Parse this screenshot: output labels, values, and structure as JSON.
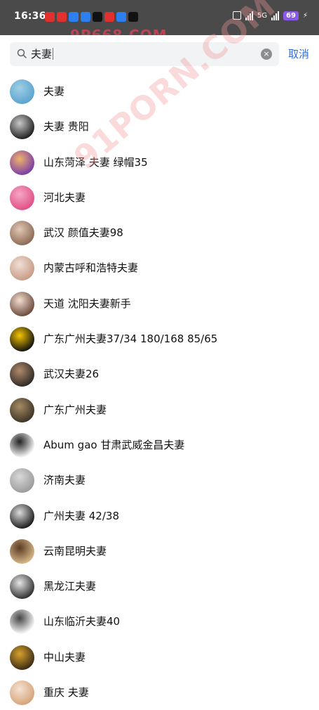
{
  "status_bar": {
    "time": "16:36",
    "battery": "69",
    "network": "5G"
  },
  "search": {
    "query": "夫妻",
    "cancel_label": "取消"
  },
  "results": [
    {
      "name": "夫妻",
      "avatar_colors": [
        "#5aa3cf",
        "#9fcfe3"
      ]
    },
    {
      "name": "夫妻  贵阳",
      "avatar_colors": [
        "#1f1f1f",
        "#c9c9c9"
      ]
    },
    {
      "name": "山东菏泽 夫妻  绿帽35",
      "avatar_colors": [
        "#7a3ca8",
        "#f0b36a"
      ]
    },
    {
      "name": "河北夫妻",
      "avatar_colors": [
        "#e04f86",
        "#f6a7c4"
      ]
    },
    {
      "name": "武汉 颜值夫妻98",
      "avatar_colors": [
        "#8a6a55",
        "#e2c7b4"
      ]
    },
    {
      "name": "内蒙古呼和浩特夫妻",
      "avatar_colors": [
        "#c89b86",
        "#f0dfd4"
      ]
    },
    {
      "name": "天道 沈阳夫妻新手",
      "avatar_colors": [
        "#6b4a3c",
        "#f3ddd0"
      ]
    },
    {
      "name": "广东广州夫妻37/34   180/168  85/65",
      "avatar_colors": [
        "#111111",
        "#f5c400"
      ]
    },
    {
      "name": "武汉夫妻26",
      "avatar_colors": [
        "#2e2a26",
        "#b08a6c"
      ]
    },
    {
      "name": "广东广州夫妻",
      "avatar_colors": [
        "#3d3326",
        "#a58b64"
      ]
    },
    {
      "name": "Abum gao  甘肃武威金昌夫妻",
      "avatar_colors": [
        "#ffffff",
        "#222222"
      ]
    },
    {
      "name": "济南夫妻",
      "avatar_colors": [
        "#9b9b9b",
        "#d8d8d8"
      ]
    },
    {
      "name": "广州夫妻  42/38",
      "avatar_colors": [
        "#1b1b1b",
        "#dcdcdc"
      ]
    },
    {
      "name": "云南昆明夫妻",
      "avatar_colors": [
        "#d9b88a",
        "#5a3a22"
      ]
    },
    {
      "name": "黑龙江夫妻",
      "avatar_colors": [
        "#303030",
        "#e6e6e6"
      ]
    },
    {
      "name": "山东临沂夫妻40",
      "avatar_colors": [
        "#ffffff",
        "#444444"
      ]
    },
    {
      "name": "中山夫妻",
      "avatar_colors": [
        "#3b2b14",
        "#d7a12e"
      ]
    },
    {
      "name": "重庆 夫妻",
      "avatar_colors": [
        "#d6a37a",
        "#f5e3d3"
      ]
    }
  ],
  "watermarks": [
    "9P668.COM",
    "91PORN.COM"
  ]
}
